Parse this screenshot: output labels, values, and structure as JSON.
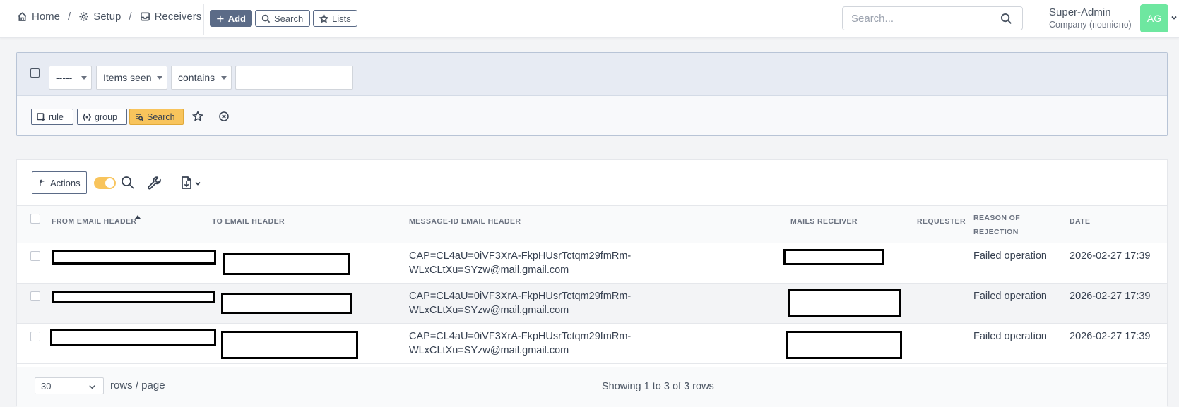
{
  "breadcrumb": {
    "home": "Home",
    "setup": "Setup",
    "receivers": "Receivers",
    "separator": "/"
  },
  "toolbar": {
    "add_label": "Add",
    "search_label": "Search",
    "lists_label": "Lists"
  },
  "global_search": {
    "placeholder": "Search..."
  },
  "user": {
    "name": "Super-Admin",
    "company": "Company (повністю)",
    "initials": "AG"
  },
  "filter": {
    "field_value": "-----",
    "attribute_value": "Items seen",
    "operator_value": "contains",
    "input_value": "",
    "rule_label": "rule",
    "group_label": "group",
    "search_label": "Search"
  },
  "table_toolbar": {
    "actions_label": "Actions",
    "live_search_on": true
  },
  "table": {
    "columns": [
      "From email header",
      "To email header",
      "Message-ID email header",
      "Mails receiver",
      "Requester",
      "Reason of",
      "rejection",
      "Date"
    ],
    "sorted_column": "From email header",
    "rows": [
      {
        "message_id_line1": "CAP=CL4aU=0iVF3XrA-FkpHUsrTctqm29fmRm-",
        "message_id_line2": "WLxCLtXu=SYzw@mail.gmail.com",
        "requester": "",
        "reason": "Failed operation",
        "date": "2026-02-27 17:39"
      },
      {
        "message_id_line1": "CAP=CL4aU=0iVF3XrA-FkpHUsrTctqm29fmRm-",
        "message_id_line2": "WLxCLtXu=SYzw@mail.gmail.com",
        "requester": "",
        "reason": "Failed operation",
        "date": "2026-02-27 17:39"
      },
      {
        "message_id_line1": "CAP=CL4aU=0iVF3XrA-FkpHUsrTctqm29fmRm-",
        "message_id_line2": "WLxCLtXu=SYzw@mail.gmail.com",
        "requester": "",
        "reason": "Failed operation",
        "date": "2026-02-27 17:39"
      }
    ]
  },
  "pagination": {
    "page_size": "30",
    "rows_per_page_label": "rows / page",
    "showing_text": "Showing 1 to 3 of 3 rows"
  },
  "colors": {
    "accent_button": "#5b6b87",
    "highlight": "#f8c45c",
    "avatar": "#6ee7a0"
  }
}
